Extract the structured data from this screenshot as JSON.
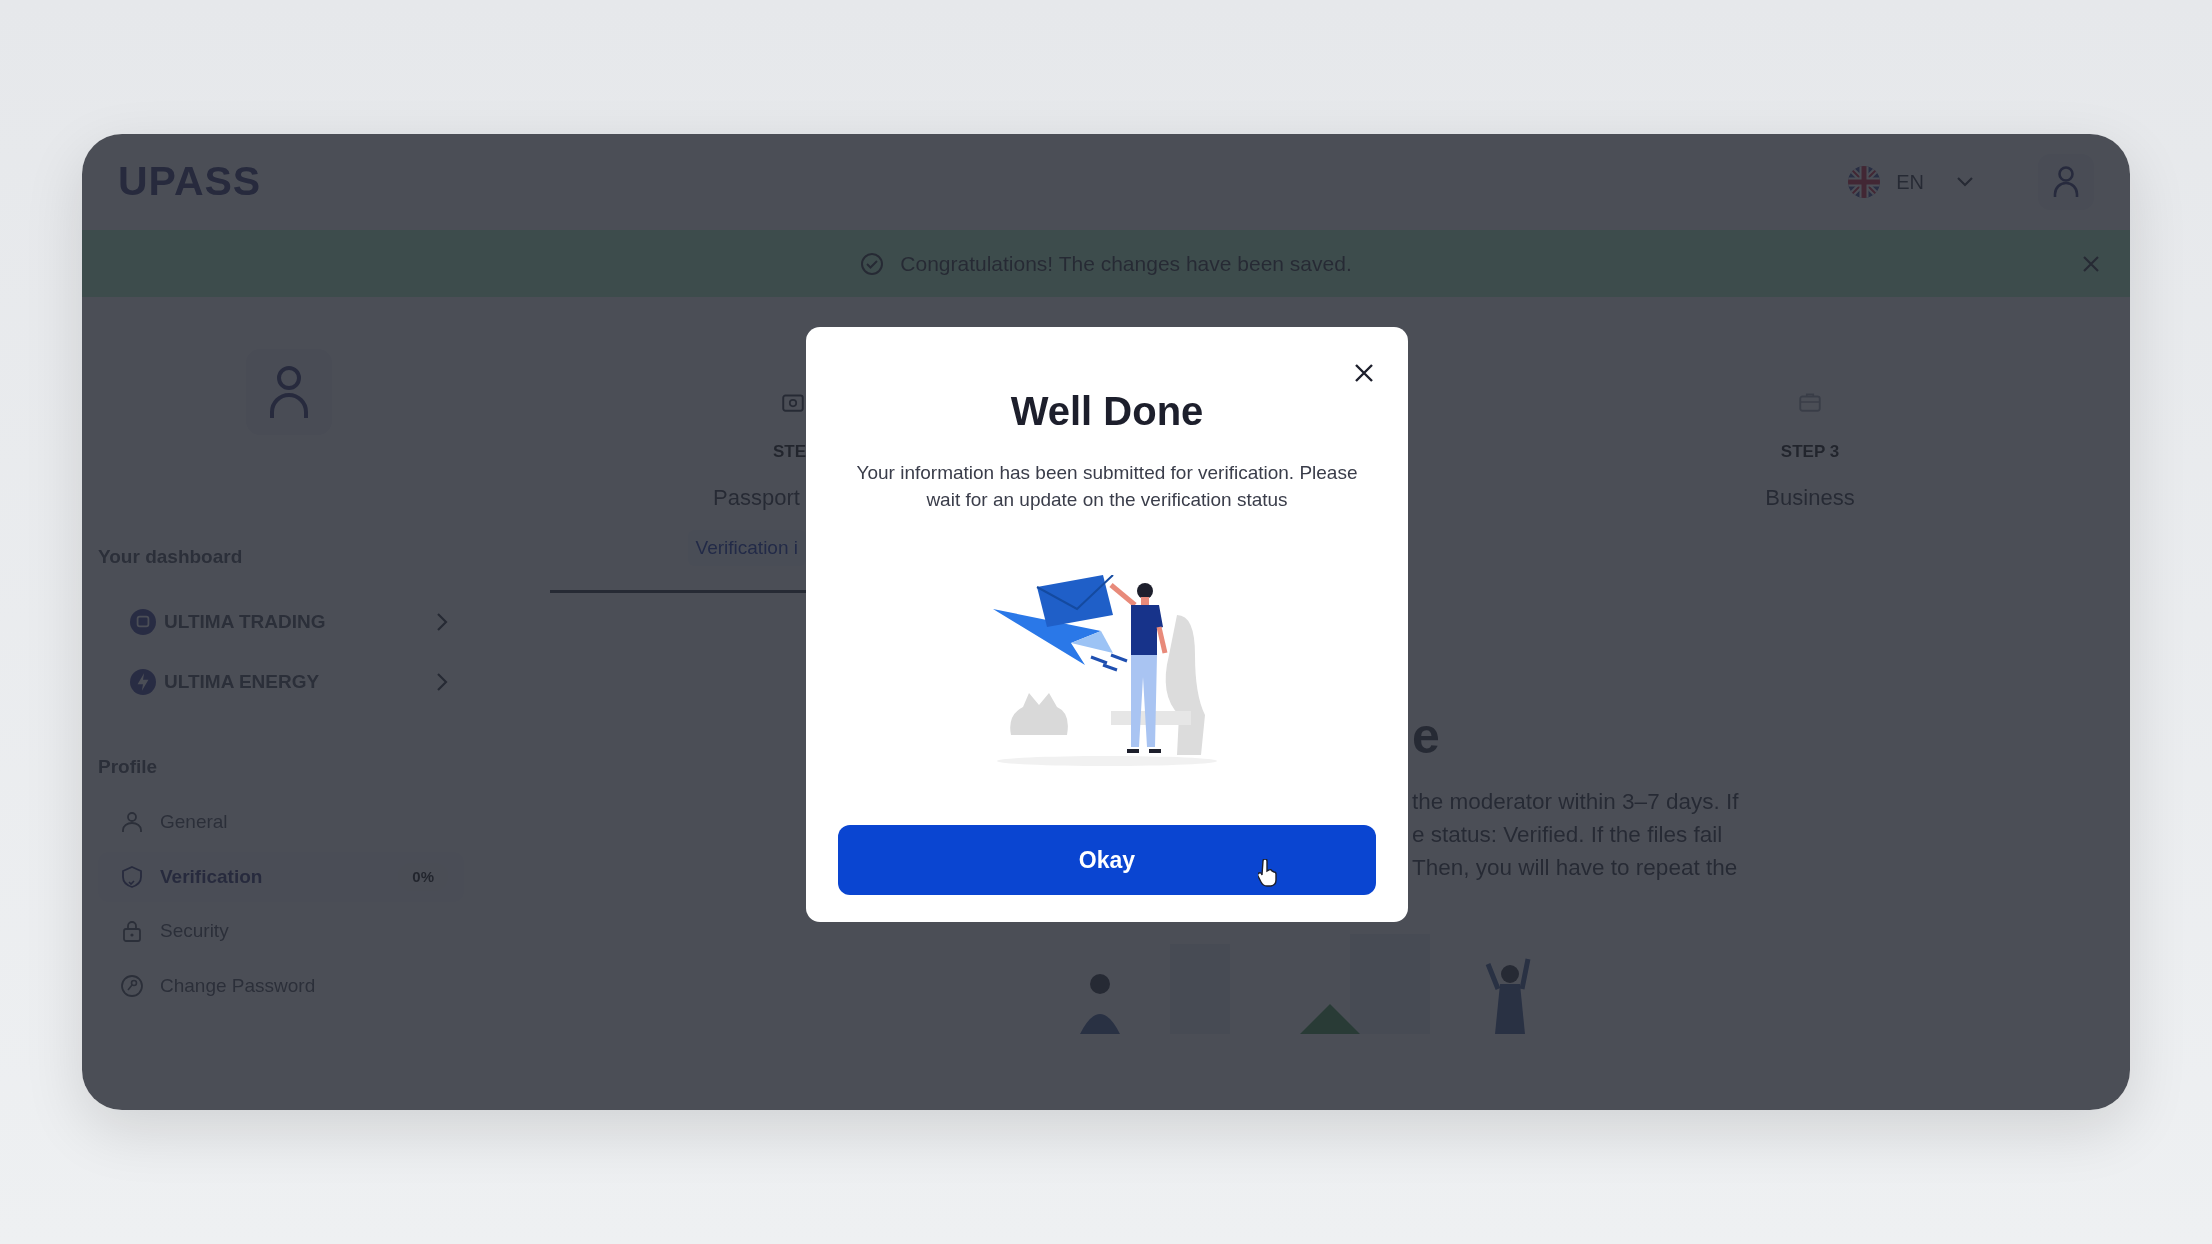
{
  "header": {
    "logo": "UPASS",
    "language": "EN"
  },
  "banner": {
    "message": "Congratulations! The changes have been saved."
  },
  "sidebar": {
    "dashboard_heading": "Your dashboard",
    "dashboard_items": [
      {
        "label": "ULTIMA TRADING",
        "kind": "trading"
      },
      {
        "label": "ULTIMA ENERGY",
        "kind": "energy"
      }
    ],
    "profile_heading": "Profile",
    "profile_items": [
      {
        "label": "General",
        "kind": "user",
        "selected": false
      },
      {
        "label": "Verification",
        "kind": "shield",
        "selected": true,
        "badge": "0%"
      },
      {
        "label": "Security",
        "kind": "lock",
        "selected": false
      },
      {
        "label": "Change Password",
        "kind": "key",
        "selected": false
      }
    ]
  },
  "steps": [
    {
      "step": "STE",
      "title": "Passport ",
      "status": "Verification i",
      "kind": "passport",
      "selected": true
    },
    {
      "step": "STEP 3",
      "title": "Business",
      "kind": "business",
      "selected": false
    }
  ],
  "content": {
    "heading": "e",
    "paragraph_lines": [
      "the moderator within 3–7 days. If",
      "e status: Verified. If the files fail",
      "Then, you will have to repeat the"
    ]
  },
  "modal": {
    "title": "Well Done",
    "message": "Your information has been submitted for verification. Please wait for an update on the verification status",
    "button": "Okay"
  }
}
